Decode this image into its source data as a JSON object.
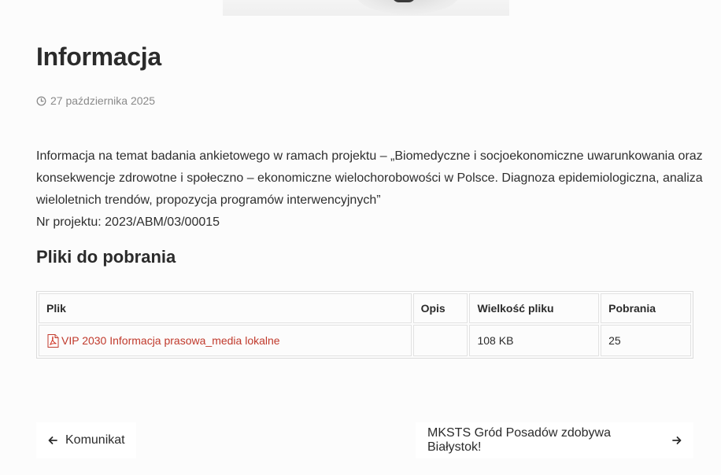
{
  "post": {
    "title": "Informacja",
    "date": "27 października 2025",
    "body": [
      "Informacja na temat badania ankietowego w ramach projektu – „Biomedyczne i socjoekonomiczne uwarunkowania oraz konsekwencje zdrowotne i społeczno – ekonomiczne wielochorobowości w Polsce. Diagnoza epidemiologiczna, analiza wieloletnich trendów, propozycja programów interwencyjnych”",
      "Nr projektu: 2023/ABM/03/00015"
    ]
  },
  "downloads": {
    "title": "Pliki do pobrania",
    "columns": [
      "Plik",
      "Opis",
      "Wielkość pliku",
      "Pobrania"
    ],
    "rows": [
      {
        "file_icon": "pdf-icon",
        "file": "VIP 2030 Informacja prasowa_media lokalne",
        "description": "",
        "size": "108 KB",
        "downloads": "25"
      }
    ]
  },
  "navigation": {
    "prev_label": "Komunikat",
    "next_label": "MKSTS Gród Posadów zdobywa Białystok!"
  },
  "colors": {
    "background": "#fcfcfc",
    "text": "#2b2b2b",
    "meta": "#8a8a8a",
    "link": "#c0392b"
  }
}
